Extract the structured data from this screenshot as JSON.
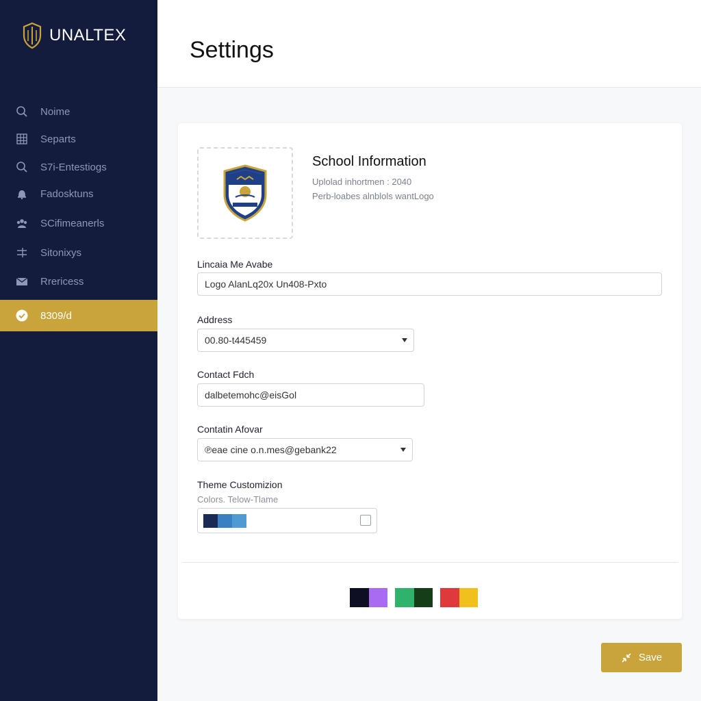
{
  "brand": {
    "name": "UNALTEX"
  },
  "sidebar": {
    "items": [
      {
        "label": "Noime",
        "icon": "search-icon"
      },
      {
        "label": "Separts",
        "icon": "grid-icon"
      },
      {
        "label": "S7i-Entestiogs",
        "icon": "search-icon"
      },
      {
        "label": "Fadosktuns",
        "icon": "bell-icon"
      },
      {
        "label": "SCifimeanerls",
        "icon": "users-icon"
      },
      {
        "label": "Sitonixys",
        "icon": "sliders-icon"
      },
      {
        "label": "Rrericess",
        "icon": "mail-icon"
      },
      {
        "label": "8309/d",
        "icon": "check-circle-icon",
        "active": true
      }
    ]
  },
  "header": {
    "title": "Settings"
  },
  "school_info": {
    "title": "School Information",
    "subtitle1": "Uplolad inhortmen : 2040",
    "subtitle2": "Perb-loabes alnblols wantLogo"
  },
  "fields": {
    "name": {
      "label": "Lincaia Me Avabe",
      "value": "Logo AlanLq20x Un408-Pxto"
    },
    "address": {
      "label": "Address",
      "value": "00.80-t445459"
    },
    "contact": {
      "label": "Contact Fdch",
      "value": "dalbetemohc@eisGol"
    },
    "contact_alt": {
      "label": "Contatin Afovar",
      "value": "℗eae cine o.n.mes@gebank22"
    }
  },
  "theme": {
    "label": "Theme Customizion",
    "sublabel": "Colors. Telow-Tlame",
    "selected_colors": [
      "#1b2a55",
      "#3a7fc1",
      "#4f9ad2"
    ],
    "palettes": [
      [
        "#0f0f24",
        "#a86bf2"
      ],
      [
        "#2fb36a",
        "#153d17"
      ],
      [
        "#e0393c",
        "#f2c01d"
      ]
    ]
  },
  "actions": {
    "save_label": "Save"
  },
  "colors": {
    "sidebar_bg": "#141c3d",
    "accent": "#c9a43a"
  }
}
